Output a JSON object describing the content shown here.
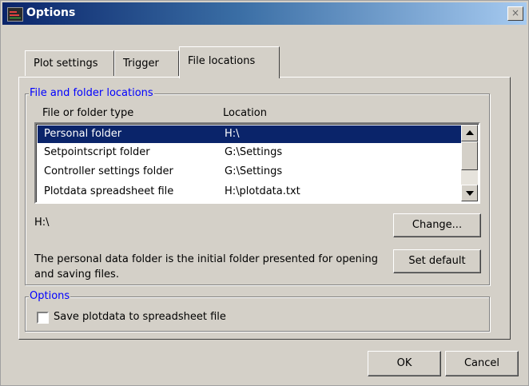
{
  "window": {
    "title": "Options",
    "close_glyph": "×"
  },
  "tabs": [
    {
      "label": "Plot settings"
    },
    {
      "label": "Trigger"
    },
    {
      "label": "File locations"
    }
  ],
  "file_group": {
    "legend": "File and folder locations",
    "columns": [
      "File or folder type",
      "Location"
    ],
    "rows": [
      {
        "type": "Personal folder",
        "location": "H:\\",
        "selected": true
      },
      {
        "type": "Setpointscript folder",
        "location": "G:\\Settings",
        "selected": false
      },
      {
        "type": "Controller settings folder",
        "location": "G:\\Settings",
        "selected": false
      },
      {
        "type": "Plotdata spreadsheet file",
        "location": "H:\\plotdata.txt",
        "selected": false
      }
    ],
    "current_path": "H:\\",
    "description": "The personal data folder is the initial folder presented for opening and saving files.",
    "change_label": "Change...",
    "set_default_label": "Set default"
  },
  "options_group": {
    "legend": "Options",
    "checkbox_label": "Save plotdata to spreadsheet file",
    "checked": false
  },
  "buttons": {
    "ok": "OK",
    "cancel": "Cancel"
  },
  "colors": {
    "selection": "#0a246a",
    "legend": "#0000ff",
    "face": "#d4d0c8"
  }
}
